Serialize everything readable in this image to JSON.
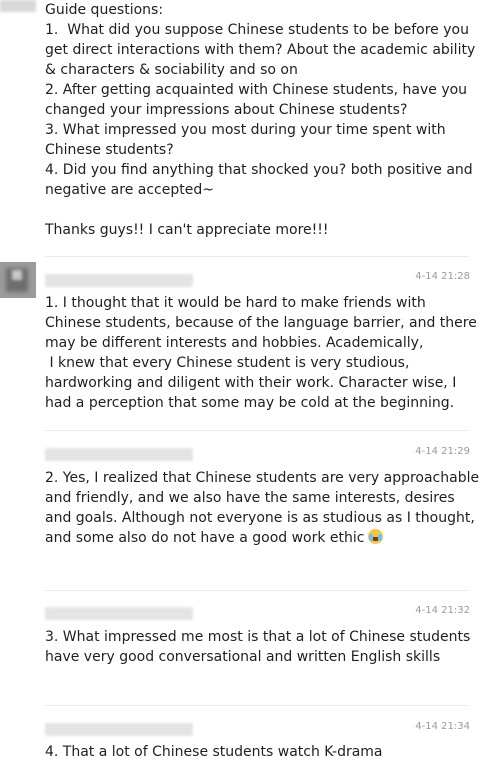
{
  "post": {
    "text": "Guide questions:\n1.  What did you suppose Chinese students to be before you get direct interactions with them? About the academic ability & characters & sociability and so on\n2. After getting acquainted with Chinese students, have you changed your impressions about Chinese students?\n3. What impressed you most during your time spent with Chinese students?\n4. Did you find anything that shocked you? both positive and negative are accepted~\n\nThanks guys!! I can't appreciate more!!!"
  },
  "replies": [
    {
      "timestamp": "4-14 21:28",
      "text": "1. I thought that it would be hard to make friends with Chinese students, because of the language barrier, and there may be different interests and hobbies. Academically,\n I knew that every Chinese student is very studious, hardworking and diligent with their work. Character wise, I had a perception that some may be cold at the beginning."
    },
    {
      "timestamp": "4-14 21:29",
      "text": "2. Yes, I realized that Chinese students are very approachable and friendly, and we also have the same interests, desires and goals. Although not everyone is as studious as I thought, and some also do not have a good work ethic",
      "emoji": "tears-of-joy-emoji"
    },
    {
      "timestamp": "4-14 21:32",
      "text": "3. What impressed me most is that a lot of Chinese students have very good conversational and written English skills"
    },
    {
      "timestamp": "4-14 21:34",
      "text": "4. That a lot of Chinese students watch K-drama"
    }
  ]
}
